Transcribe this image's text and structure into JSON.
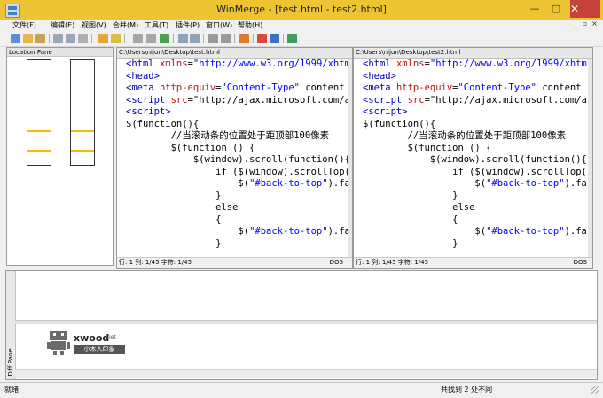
{
  "window": {
    "title": "WinMerge - [test.html - test2.html]",
    "minimize": "—",
    "maximize": "▢",
    "close": "✕"
  },
  "menu": {
    "items": [
      "文件(F)",
      "编辑(E)",
      "视图(V)",
      "合并(M)",
      "工具(T)",
      "插件(P)",
      "窗口(W)",
      "帮助(H)"
    ],
    "mdi": [
      "_",
      "▫",
      "×"
    ]
  },
  "location_pane": {
    "label": "Location Pane"
  },
  "left_pane": {
    "path": "C:\\Users\\nijun\\Desktop\\test.html",
    "status": {
      "position": "行: 1  列: 1/45  字符: 1/45",
      "eol": "DOS"
    }
  },
  "right_pane": {
    "path": "C:\\Users\\nijun\\Desktop\\test2.html",
    "status": {
      "position": "行: 1  列: 1/45  字符: 1/45",
      "eol": "DOS"
    }
  },
  "code_lines": [
    "<html xmlns=\"http://www.w3.org/1999/xhtml\">",
    "<head>",
    "<meta http-equiv=\"Content-Type\" content",
    "<script src=\"http://ajax.microsoft.com/a",
    "<script>",
    "$(function(){",
    "        //当滚动条的位置处于距顶部100像素",
    "        $(function () {",
    "            $(window).scroll(function(){",
    "                if ($(window).scrollTop()",
    "                    $(\"#back-to-top\").fa",
    "                }",
    "                else",
    "                {",
    "                    $(\"#back-to-top\").fa",
    "                }"
  ],
  "diff_pane": {
    "label": "Diff Pane"
  },
  "logo": {
    "name": "xwood",
    "suffix": ".net",
    "subtitle": "小木人印象"
  },
  "status": {
    "left": "就绪",
    "right": "共找到 2 处不同"
  },
  "colors": {
    "titlebar": "#efc433",
    "close": "#c7423a",
    "diff_highlight": "#f0c000"
  }
}
